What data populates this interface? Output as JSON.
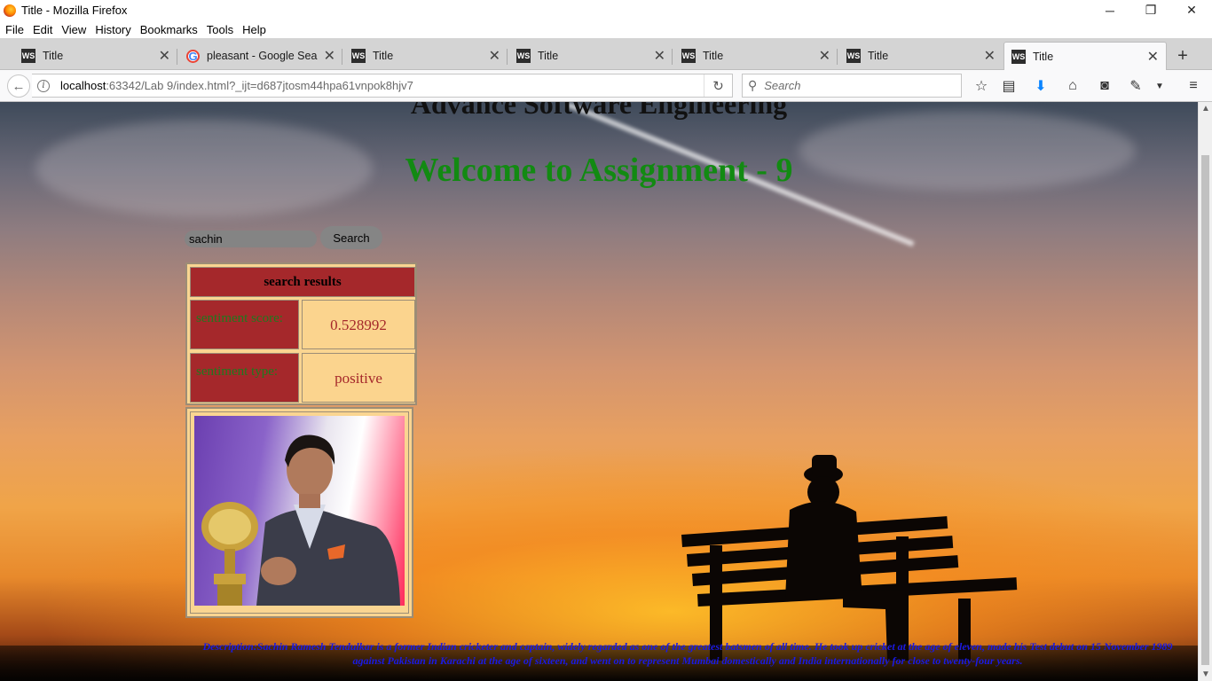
{
  "window": {
    "title": "Title - Mozilla Firefox",
    "controls": {
      "minimize": "─",
      "restore": "❐",
      "close": "✕"
    }
  },
  "menubar": {
    "items": [
      "File",
      "Edit",
      "View",
      "History",
      "Bookmarks",
      "Tools",
      "Help"
    ]
  },
  "tabs": [
    {
      "label": "Title",
      "icon": "webstorm-icon",
      "active": false
    },
    {
      "label": "pleasant - Google Sea...",
      "icon": "google-icon",
      "active": false
    },
    {
      "label": "Title",
      "icon": "webstorm-icon",
      "active": false
    },
    {
      "label": "Title",
      "icon": "webstorm-icon",
      "active": false
    },
    {
      "label": "Title",
      "icon": "webstorm-icon",
      "active": false
    },
    {
      "label": "Title",
      "icon": "webstorm-icon",
      "active": false
    },
    {
      "label": "Title",
      "icon": "webstorm-icon",
      "active": true
    }
  ],
  "tab_icon_text": {
    "webstorm": "WS",
    "google": "G"
  },
  "navbar": {
    "url_host": "localhost",
    "url_rest": ":63342/Lab 9/index.html?_ijt=d687jtosm44hpa61vnpok8hjv7",
    "search_placeholder": "Search",
    "icons": [
      "star-icon",
      "reading-list-icon",
      "download-icon",
      "home-icon",
      "pocket-icon",
      "extension-icon",
      "menu-dropdown-icon",
      "hamburger-menu-icon"
    ]
  },
  "page": {
    "heading_top": "Advance Software Engineering",
    "heading_main": "Welcome to Assignment - 9",
    "search_value": "sachin",
    "search_button": "Search",
    "results": {
      "header": "search results",
      "rows": [
        {
          "label": "sentiment score:",
          "value": "0.528992"
        },
        {
          "label": "sentiment type:",
          "value": "positive"
        }
      ]
    },
    "description": "Description:Sachin Ramesh Tendulkar is a former Indian cricketer and captain, widely regarded as one of the greatest batsmen of all time. He took up cricket at the age of eleven, made his Test debut on 15 November 1989 against Pakistan in Karachi at the age of sixteen, and went on to represent Mumbai domestically and India internationally for close to twenty-four years."
  },
  "colors": {
    "heading_green": "#128a12",
    "table_red": "#a5282b",
    "table_tan": "#fad591",
    "description_blue": "#1a1ae6"
  }
}
